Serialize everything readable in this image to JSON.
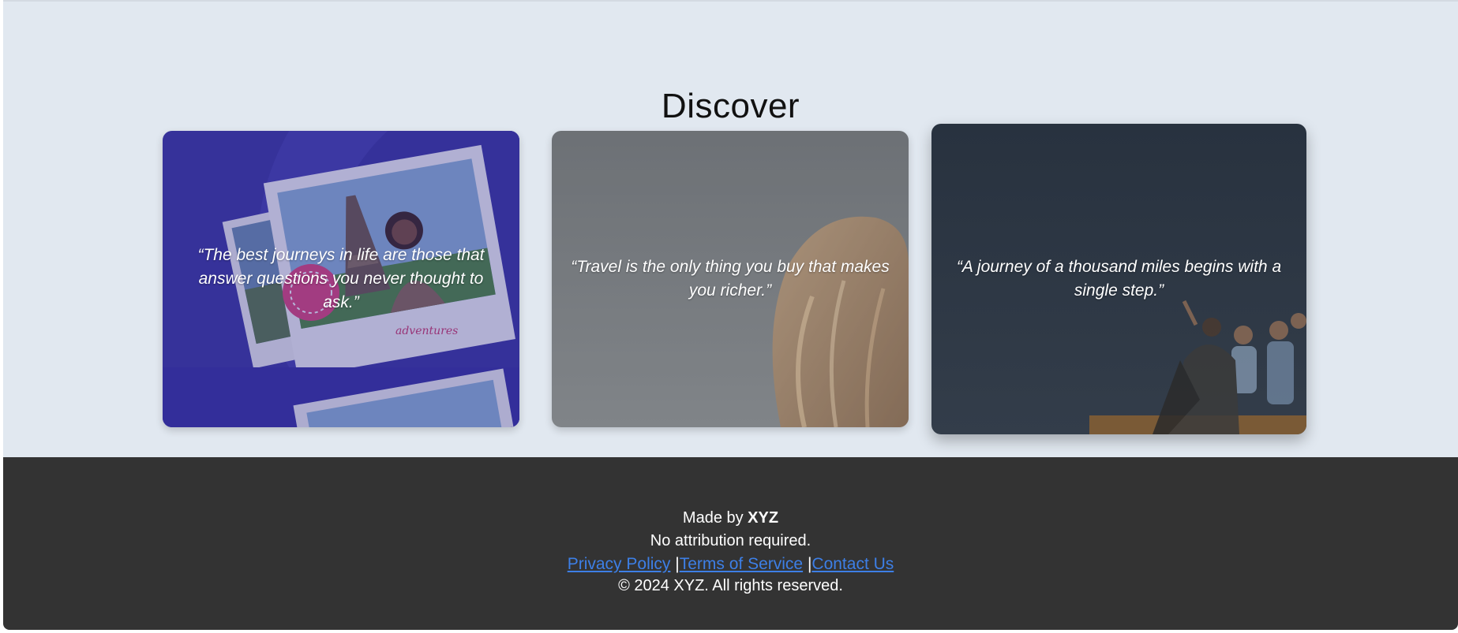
{
  "section": {
    "title": "Discover"
  },
  "cards": [
    {
      "quote": "“The best journeys in life are those that answer questions you never thought to ask.”",
      "image_text": "adventures"
    },
    {
      "quote": "“Travel is the only thing you buy that makes you richer.”"
    },
    {
      "quote": "“A journey of a thousand miles begins with a single step.”"
    }
  ],
  "footer": {
    "made_by_prefix": "Made by ",
    "made_by_name": "XYZ",
    "attribution": "No attribution required.",
    "links": {
      "privacy": "Privacy Policy",
      "terms": "Terms of Service",
      "contact": "Contact Us",
      "separator": "|"
    },
    "copyright": "© 2024 XYZ. All rights reserved."
  },
  "colors": {
    "page_background": "#e1e8f0",
    "footer_background": "#333333",
    "link": "#3d7fe6",
    "card1_overlay": "#2e2a8f",
    "card2_overlay": "#707478",
    "card3_overlay": "#28323f"
  }
}
